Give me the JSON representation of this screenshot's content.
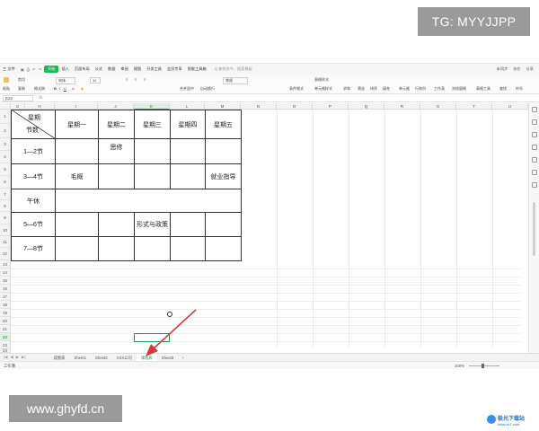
{
  "watermarks": {
    "top": "TG: MYYJJPP",
    "bottom": "www.ghyfd.cn"
  },
  "menu": {
    "file": "三 文件",
    "items": [
      "开始",
      "插入",
      "页面布局",
      "公式",
      "数据",
      "审阅",
      "视图",
      "开发工具",
      "会员专享",
      "智能工具箱"
    ],
    "active_index": 0,
    "search": "Q 查找命令、搜索模板",
    "right": [
      "未同步",
      "协作",
      "分享"
    ]
  },
  "ribbon": {
    "labels": [
      "格式刷",
      "粘贴",
      "剪切",
      "复制",
      "宋体",
      "11",
      "常规",
      "合并居中",
      "自动换行",
      "条件格式",
      "表格样式",
      "单元格样式",
      "求和",
      "筛选",
      "排序",
      "填充",
      "单元格",
      "行和列",
      "工作表",
      "冻结窗格",
      "表格工具",
      "查找",
      "符号"
    ]
  },
  "formula_bar": {
    "name_box": "E22",
    "fx": "fx"
  },
  "columns": [
    "G",
    "H",
    "I",
    "J",
    "K",
    "L",
    "M",
    "N",
    "O",
    "P",
    "Q",
    "R",
    "S",
    "T",
    "U"
  ],
  "selected_column": "K",
  "rows": [
    "1",
    "2",
    "3",
    "4",
    "5",
    "6",
    "7",
    "8",
    "9",
    "10",
    "11",
    "12",
    "13",
    "14",
    "15",
    "16",
    "17",
    "18",
    "19",
    "20",
    "21",
    "22",
    "23",
    "24"
  ],
  "selected_row": "22",
  "table": {
    "corner_top": "星期",
    "corner_bottom": "节数",
    "days": [
      "星期一",
      "星期二",
      "星期三",
      "星期四",
      "星期五"
    ],
    "periods": [
      "1—2节",
      "3—4节",
      "午休",
      "5—6节",
      "7—8节"
    ],
    "entries": {
      "p1_d2": "思修",
      "p2_d1": "毛概",
      "p2_d5": "就业指导",
      "p4_d3": "形式与政策"
    }
  },
  "sheet_tabs": [
    "成绩表",
    "Sheet1",
    "Sheet2",
    "XXX公司",
    "课程表",
    "Sheet3"
  ],
  "active_tab": "课程表",
  "status": {
    "left": "工作簿",
    "zoom": "100%"
  },
  "logo": {
    "name": "极光下载站",
    "url": "www.xz7.com"
  },
  "colors": {
    "accent": "#1db954",
    "arrow": "#d13b3b",
    "selection": "#1a9a4c"
  }
}
